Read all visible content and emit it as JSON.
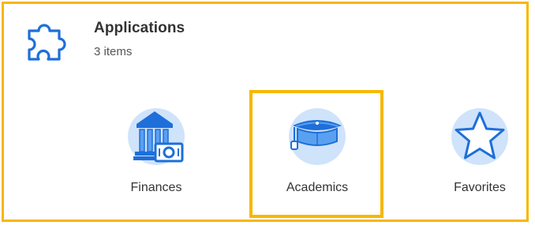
{
  "header": {
    "title": "Applications",
    "subtitle": "3 items",
    "icon": "puzzle-piece-icon"
  },
  "apps": [
    {
      "label": "Finances",
      "icon": "bank-money-icon"
    },
    {
      "label": "Academics",
      "icon": "graduation-cap-icon",
      "highlighted": true
    },
    {
      "label": "Favorites",
      "icon": "star-icon"
    }
  ],
  "colors": {
    "highlight": "#f6b800",
    "icon_blue": "#1e6fd9",
    "icon_bg": "#cfe3fb",
    "icon_light": "#5aa0f0"
  }
}
